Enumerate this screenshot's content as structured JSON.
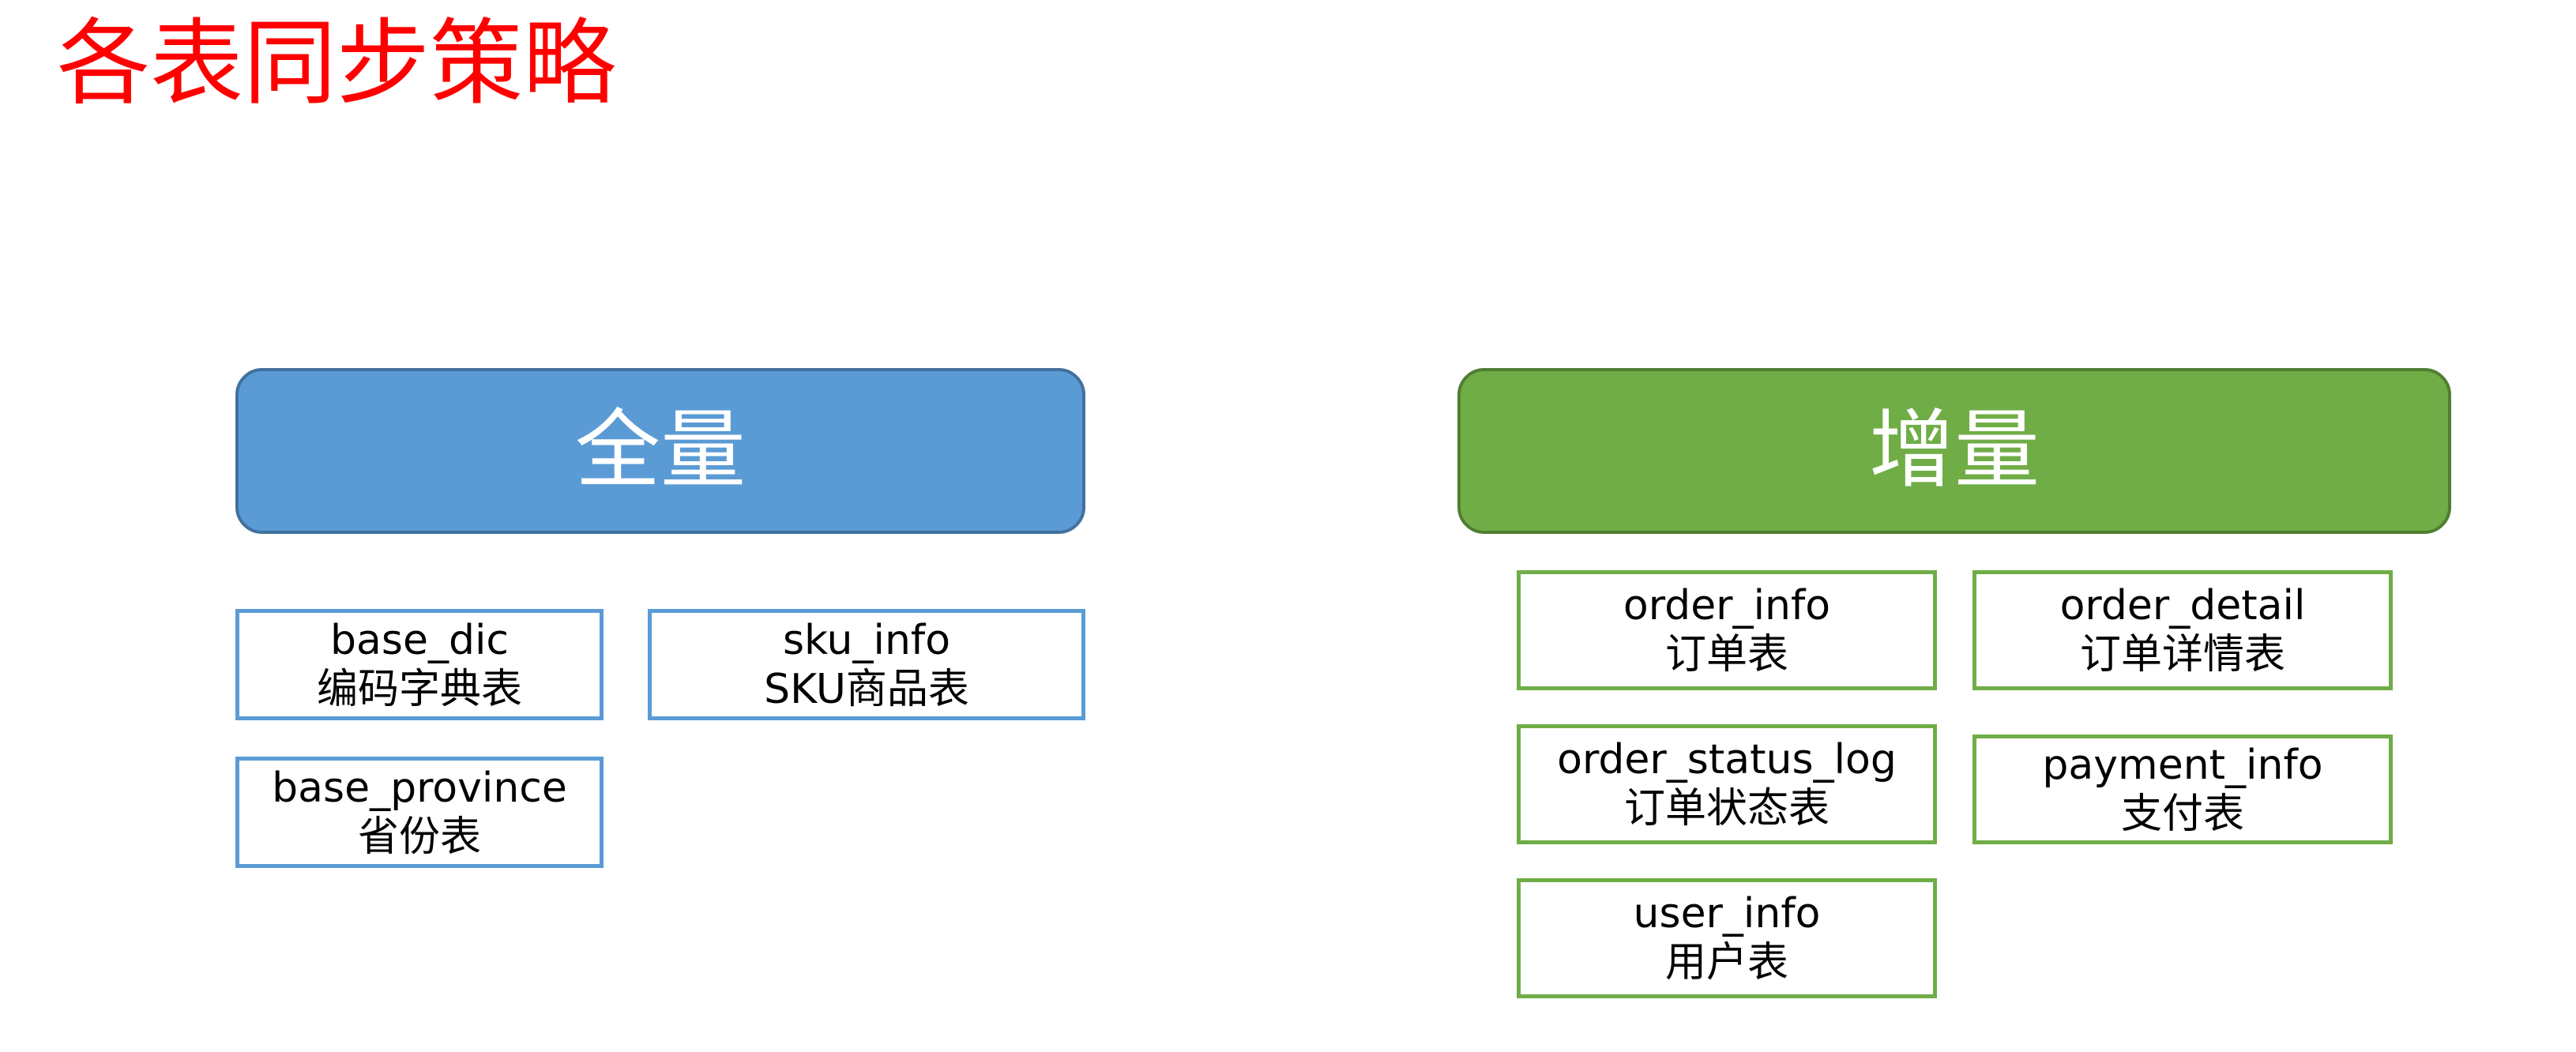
{
  "title": "各表同步策略",
  "colors": {
    "title": "#ff0000",
    "full_header": "#5b9bd5",
    "incremental_header": "#70ad47"
  },
  "full": {
    "label": "全量",
    "tables": [
      {
        "name": "base_dic",
        "desc": "编码字典表"
      },
      {
        "name": "sku_info",
        "desc": "SKU商品表"
      },
      {
        "name": "base_province",
        "desc": "省份表"
      }
    ]
  },
  "incremental": {
    "label": "增量",
    "tables": [
      {
        "name": "order_info",
        "desc": "订单表"
      },
      {
        "name": "order_detail",
        "desc": "订单详情表"
      },
      {
        "name": "order_status_log",
        "desc": "订单状态表"
      },
      {
        "name": "payment_info",
        "desc": "支付表"
      },
      {
        "name": "user_info",
        "desc": "用户表"
      }
    ]
  }
}
